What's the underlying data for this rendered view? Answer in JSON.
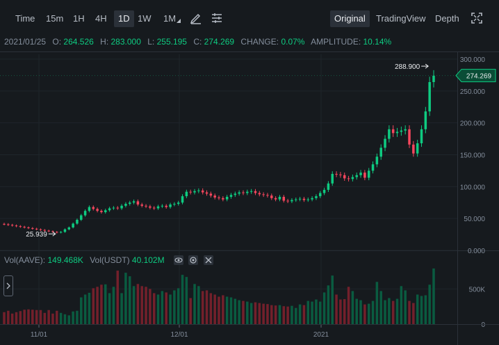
{
  "toolbar": {
    "intervals": [
      "Time",
      "15m",
      "1H",
      "4H",
      "1D",
      "1W",
      "1M"
    ],
    "active_interval": "1D",
    "views": [
      "Original",
      "TradingView",
      "Depth"
    ],
    "active_view": "Original"
  },
  "ohlc": {
    "date": "2021/01/25",
    "open_label": "O:",
    "open": "264.526",
    "high_label": "H:",
    "high": "283.000",
    "low_label": "L:",
    "low": "255.195",
    "close_label": "C:",
    "close": "274.269",
    "change_label": "CHANGE:",
    "change": "0.07%",
    "amplitude_label": "AMPLITUDE:",
    "amplitude": "10.14%"
  },
  "price_axis": {
    "ticks": [
      "300.000",
      "250.000",
      "200.000",
      "150.000",
      "100.000",
      "50.000",
      "0.000"
    ],
    "current_price": "274.269",
    "max_marker": "288.900",
    "min_marker": "25.939"
  },
  "volume": {
    "label1": "Vol(AAVE):",
    "value1": "149.468K",
    "label2": "Vol(USDT)",
    "value2": "40.102M",
    "ticks": [
      "500K",
      "0"
    ]
  },
  "time_axis": [
    "11/01",
    "12/01",
    "2021"
  ],
  "colors": {
    "up": "#0ecb81",
    "down": "#f6465d",
    "up_vol": "#0a5b40",
    "down_vol": "#73202b",
    "bg": "#161a1e"
  },
  "chart_data": {
    "type": "candlestick",
    "x_labels": [
      "11/01",
      "12/01",
      "2021"
    ],
    "y_range": [
      0,
      300
    ],
    "last_close": 274.269,
    "high_marker": 288.9,
    "low_marker": 25.939,
    "close_series": [
      41,
      40,
      39,
      38,
      37,
      36,
      35,
      34,
      33,
      32,
      31,
      30,
      29,
      28,
      29,
      33,
      36,
      42,
      48,
      55,
      62,
      68,
      65,
      62,
      60,
      63,
      66,
      67,
      66,
      70,
      73,
      75,
      77,
      72,
      70,
      69,
      67,
      66,
      69,
      70,
      68,
      72,
      73,
      75,
      85,
      92,
      91,
      93,
      94,
      91,
      89,
      86,
      83,
      82,
      80,
      84,
      87,
      89,
      91,
      90,
      92,
      93,
      90,
      88,
      87,
      86,
      82,
      80,
      84,
      78,
      77,
      79,
      80,
      81,
      79,
      80,
      82,
      85,
      90,
      95,
      105,
      120,
      119,
      118,
      113,
      112,
      115,
      118,
      122,
      114,
      125,
      135,
      147,
      161,
      175,
      190,
      184,
      186,
      188,
      190,
      166,
      152,
      168,
      190,
      218,
      264,
      274
    ],
    "volume_series": [
      170,
      190,
      150,
      170,
      185,
      205,
      210,
      205,
      200,
      200,
      160,
      200,
      150,
      190,
      160,
      140,
      125,
      180,
      190,
      380,
      420,
      445,
      510,
      530,
      560,
      565,
      440,
      530,
      760,
      440,
      730,
      680,
      540,
      570,
      540,
      530,
      500,
      440,
      420,
      470,
      450,
      420,
      480,
      510,
      700,
      670,
      370,
      570,
      540,
      470,
      480,
      440,
      420,
      390,
      410,
      390,
      380,
      360,
      340,
      330,
      320,
      300,
      310,
      300,
      290,
      285,
      270,
      265,
      270,
      255,
      250,
      260,
      230,
      280,
      270,
      330,
      320,
      350,
      320,
      450,
      550,
      690,
      420,
      350,
      355,
      530,
      470,
      360,
      340,
      280,
      290,
      330,
      600,
      470,
      340,
      370,
      330,
      360,
      540,
      480,
      330,
      300,
      420,
      400,
      410,
      560,
      790
    ]
  }
}
